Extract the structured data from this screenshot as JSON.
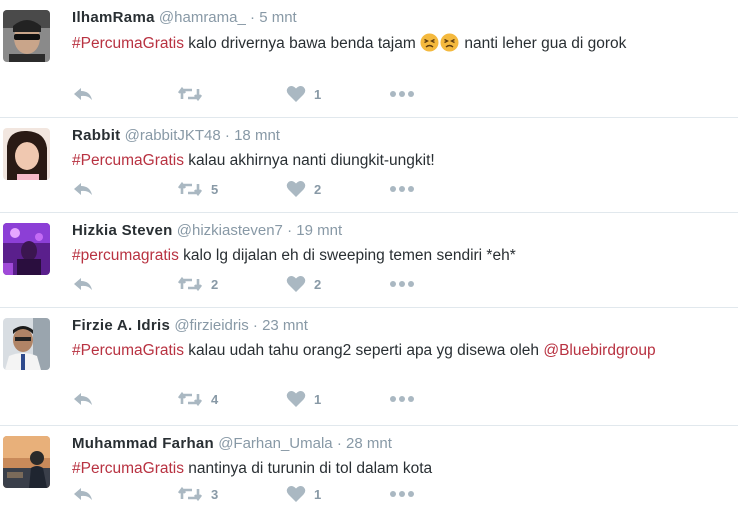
{
  "tweets": [
    {
      "name": "IlhamRama",
      "handle": "@hamrama_",
      "separator": "·",
      "time": "5 mnt",
      "hashtag": "#PercumaGratis",
      "text": "kalo drivernya bawa benda tajam",
      "text_after_emoji": "nanti leher gua di gorok",
      "emoji": "persevering-face-emoji",
      "retweets": "",
      "likes": "1"
    },
    {
      "name": "Rabbit",
      "handle": "@rabbitJKT48",
      "separator": "·",
      "time": "18 mnt",
      "hashtag": "#PercumaGratis",
      "text": "kalau akhirnya nanti diungkit-ungkit!",
      "retweets": "5",
      "likes": "2"
    },
    {
      "name": "Hizkia Steven",
      "handle": "@hizkiasteven7",
      "separator": "·",
      "time": "19 mnt",
      "hashtag": "#percumagratis",
      "text": "kalo lg dijalan eh di sweeping temen sendiri *eh*",
      "retweets": "2",
      "likes": "2"
    },
    {
      "name": "Firzie A. Idris",
      "handle": "@firzieidris",
      "separator": "·",
      "time": "23 mnt",
      "hashtag": "#PercumaGratis",
      "text": "kalau udah tahu orang2 seperti apa yg disewa oleh",
      "mention": "@Bluebirdgroup",
      "retweets": "4",
      "likes": "1"
    },
    {
      "name": "Muhammad Farhan",
      "handle": "@Farhan_Umala",
      "separator": "·",
      "time": "28 mnt",
      "hashtag": "#PercumaGratis",
      "text": "nantinya di turunin di tol dalam kota",
      "retweets": "3",
      "likes": "1"
    }
  ],
  "colors": {
    "hashtag": "#b83241",
    "meta": "#8899a6",
    "icon": "#aab8c2",
    "divider": "#e1e8ed"
  }
}
